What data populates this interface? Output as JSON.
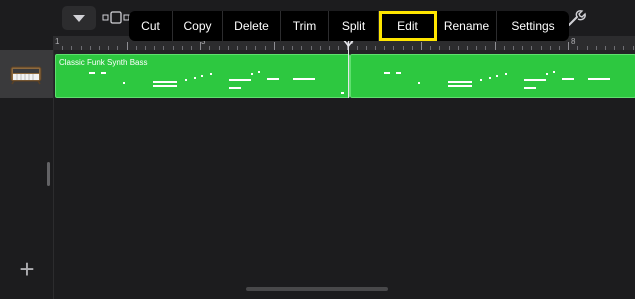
{
  "edit_menu": {
    "items": [
      "Cut",
      "Copy",
      "Delete",
      "Trim",
      "Split",
      "Edit",
      "Rename",
      "Settings"
    ],
    "highlighted": "Edit",
    "highlight_color": "#ffe600"
  },
  "ruler": {
    "bar_numbers": [
      "1",
      "3",
      "5",
      "8"
    ]
  },
  "track": {
    "region_name": "Classic Funk Synth Bass",
    "region_color": "#2dc840",
    "icon": "synth-keyboard-icon"
  },
  "controls": {
    "add_track_symbol": "+",
    "icons": [
      "chevron-down-icon",
      "view-toggle-icon",
      "wrench-icon",
      "playhead-icon"
    ]
  }
}
